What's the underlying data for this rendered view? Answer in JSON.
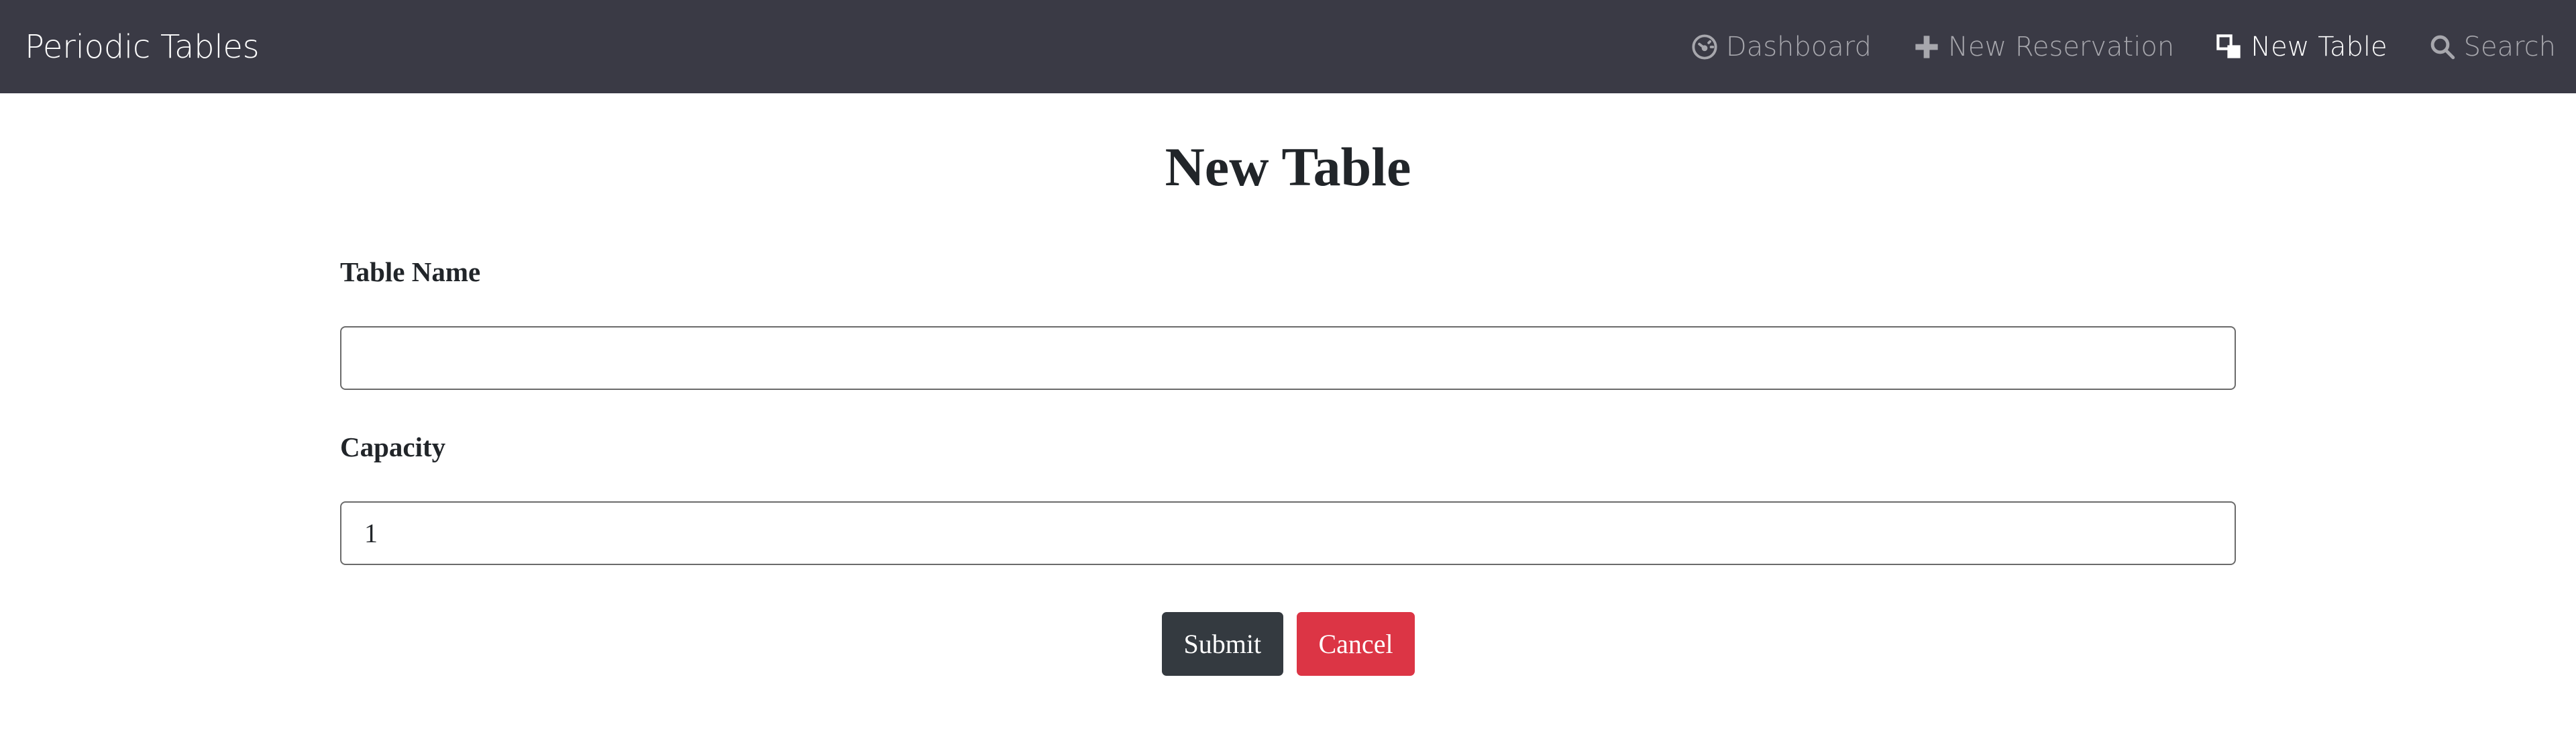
{
  "navbar": {
    "brand": "Periodic Tables",
    "links": [
      {
        "label": "Dashboard",
        "icon": "dashboard-icon",
        "active": false
      },
      {
        "label": "New Reservation",
        "icon": "plus-icon",
        "active": false
      },
      {
        "label": "New Table",
        "icon": "layers-icon",
        "active": true
      },
      {
        "label": "Search",
        "icon": "search-icon",
        "active": false
      }
    ]
  },
  "main": {
    "title": "New Table",
    "form": {
      "table_name": {
        "label": "Table Name",
        "value": ""
      },
      "capacity": {
        "label": "Capacity",
        "value": "1"
      },
      "submit_label": "Submit",
      "cancel_label": "Cancel"
    }
  },
  "colors": {
    "navbar_bg": "#3a3a45",
    "submit_bg": "#343a40",
    "cancel_bg": "#dc3545"
  }
}
